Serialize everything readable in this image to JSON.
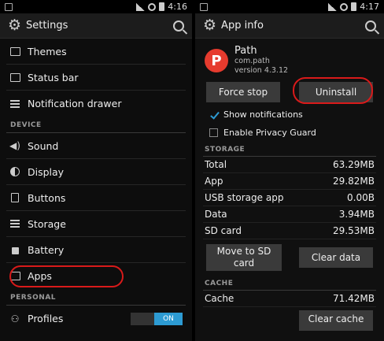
{
  "left": {
    "status_time": "4:16",
    "title": "Settings",
    "items_top": [
      {
        "label": "Themes",
        "icon": "brush-icon"
      },
      {
        "label": "Status bar",
        "icon": "statusbar-icon"
      },
      {
        "label": "Notification drawer",
        "icon": "drawer-icon"
      }
    ],
    "section_device": "DEVICE",
    "items_device": [
      {
        "label": "Sound",
        "icon": "speaker-icon"
      },
      {
        "label": "Display",
        "icon": "display-icon"
      },
      {
        "label": "Buttons",
        "icon": "buttons-icon"
      },
      {
        "label": "Storage",
        "icon": "storage-icon"
      },
      {
        "label": "Battery",
        "icon": "battery-icon"
      },
      {
        "label": "Apps",
        "icon": "apps-icon"
      }
    ],
    "section_personal": "PERSONAL",
    "profiles_label": "Profiles",
    "profiles_toggle": "ON"
  },
  "right": {
    "status_time": "4:17",
    "title": "App info",
    "app_name": "Path",
    "app_package": "com.path",
    "app_version": "version 4.3.12",
    "force_stop": "Force stop",
    "uninstall": "Uninstall",
    "show_notifications": "Show notifications",
    "privacy_guard": "Enable Privacy Guard",
    "storage_head": "STORAGE",
    "storage": [
      {
        "label": "Total",
        "value": "63.29MB"
      },
      {
        "label": "App",
        "value": "29.82MB"
      },
      {
        "label": "USB storage app",
        "value": "0.00B"
      },
      {
        "label": "Data",
        "value": "3.94MB"
      },
      {
        "label": "SD card",
        "value": "29.53MB"
      }
    ],
    "move_sd": "Move to SD card",
    "clear_data": "Clear data",
    "cache_head": "CACHE",
    "cache_label": "Cache",
    "cache_value": "71.42MB",
    "clear_cache": "Clear cache"
  }
}
